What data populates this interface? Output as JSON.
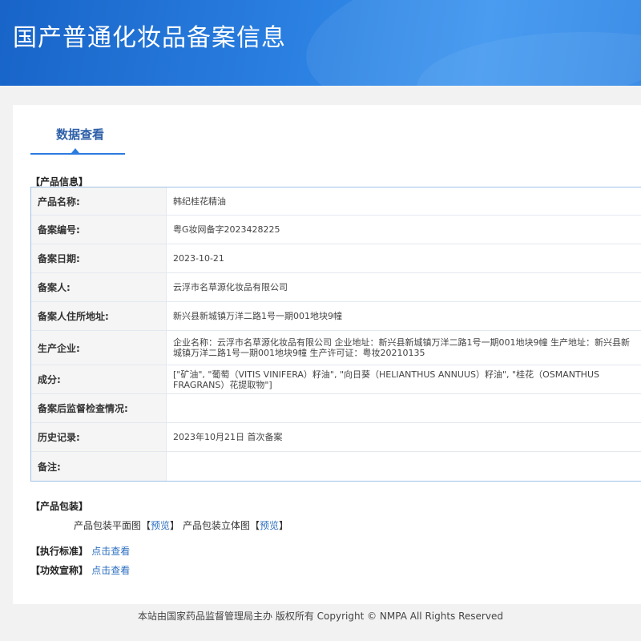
{
  "header": {
    "title": "国产普通化妆品备案信息"
  },
  "tab": {
    "label": "数据查看"
  },
  "product_info": {
    "section_title": "【产品信息】",
    "rows": [
      {
        "label": "产品名称:",
        "value": "韩纪桂花精油"
      },
      {
        "label": "备案编号:",
        "value": "粤G妆网备字2023428225"
      },
      {
        "label": "备案日期:",
        "value": "2023-10-21"
      },
      {
        "label": "备案人:",
        "value": "云浮市名草源化妆品有限公司"
      },
      {
        "label": "备案人住所地址:",
        "value": "新兴县新城镇万洋二路1号一期001地块9幢"
      },
      {
        "label": "生产企业:",
        "value": "企业名称：云浮市名草源化妆品有限公司 企业地址：新兴县新城镇万洋二路1号一期001地块9幢 生产地址：新兴县新城镇万洋二路1号一期001地块9幢 生产许可证：粤妆20210135"
      },
      {
        "label": "成分:",
        "value": "[\"矿油\", \"葡萄（VITIS VINIFERA）籽油\", \"向日葵（HELIANTHUS ANNUUS）籽油\", \"桂花（OSMANTHUS FRAGRANS）花提取物\"]"
      },
      {
        "label": "备案后监督检查情况:",
        "value": ""
      },
      {
        "label": "历史记录:",
        "value": "2023年10月21日 首次备案"
      },
      {
        "label": "备注:",
        "value": ""
      }
    ]
  },
  "packaging": {
    "section_title": "【产品包装】",
    "flat_label": "产品包装平面图",
    "stereo_label": "产品包装立体图",
    "bracket_open": "【",
    "bracket_close": "】",
    "preview_link": "预览"
  },
  "standard": {
    "section_title": "【执行标准】",
    "link": "点击查看"
  },
  "efficacy": {
    "section_title": "【功效宣称】",
    "link": "点击查看"
  },
  "footer": {
    "text": "本站由国家药品监督管理局主办 版权所有 Copyright © NMPA All Rights Reserved"
  }
}
